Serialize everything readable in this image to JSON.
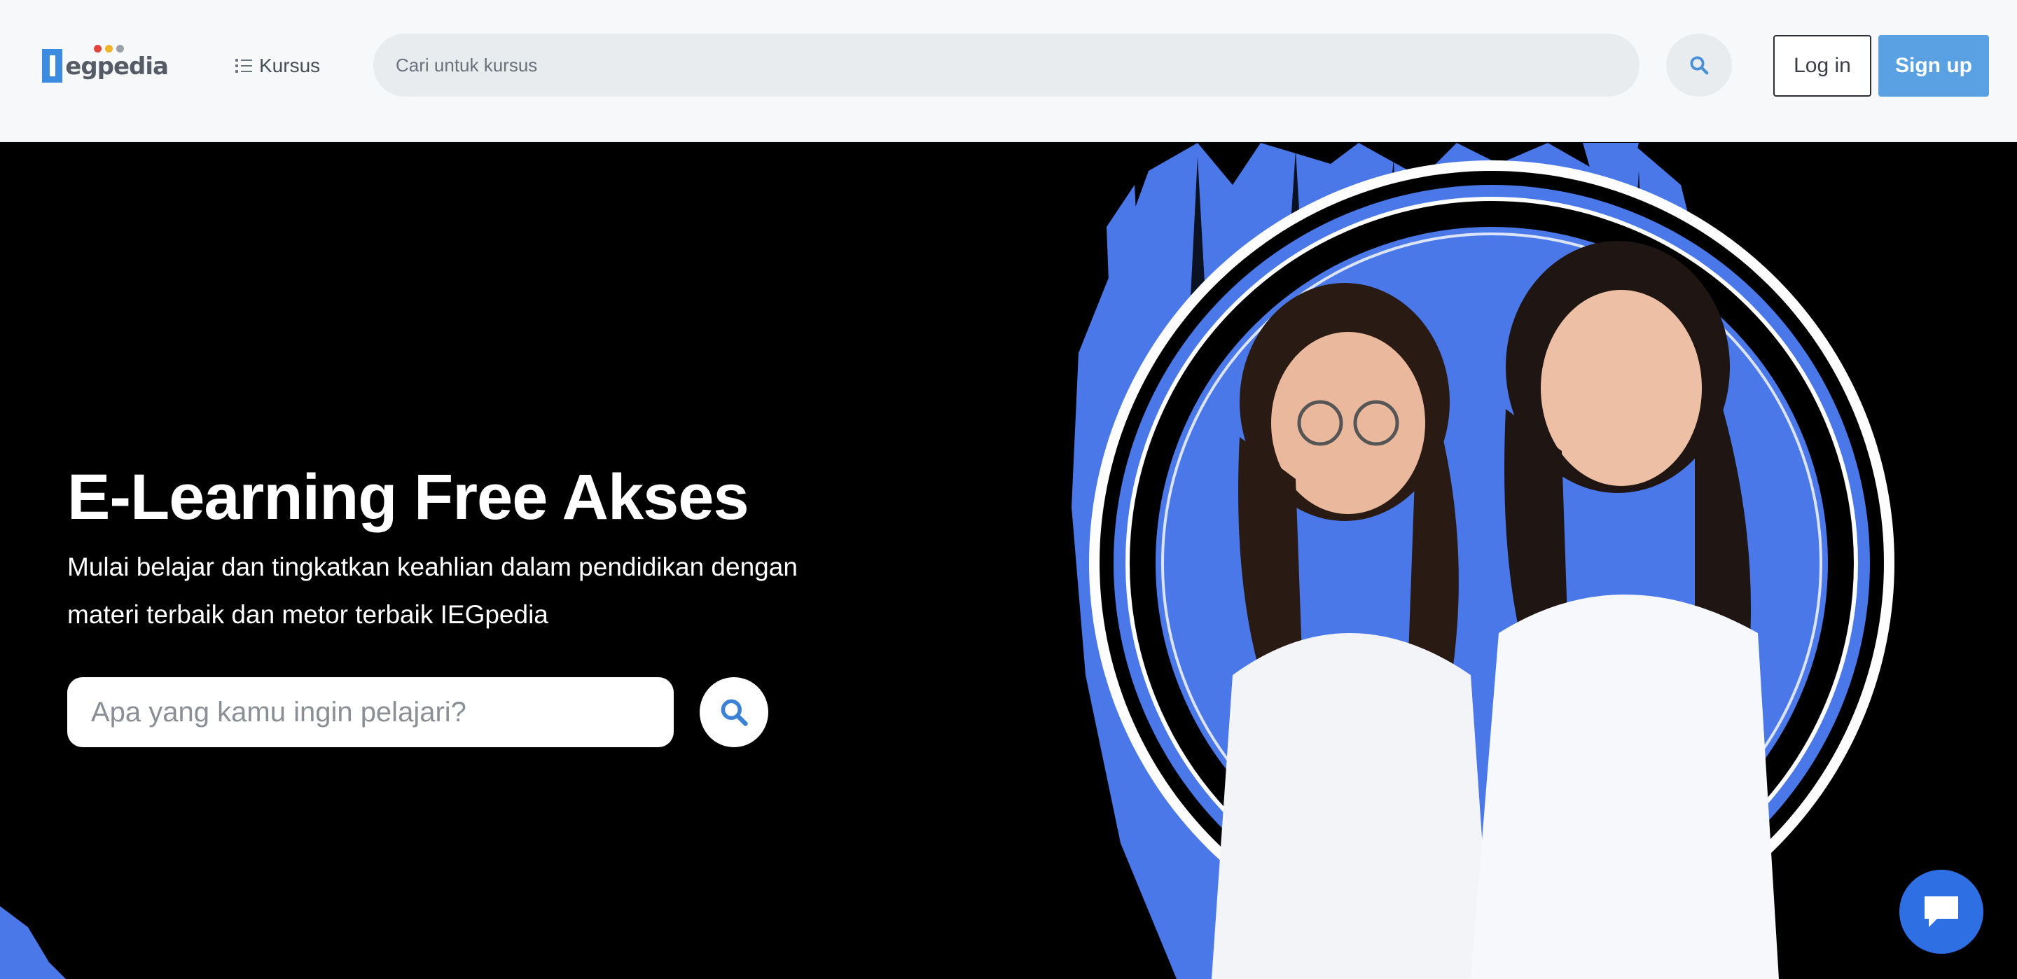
{
  "header": {
    "logo_text": "egpedia",
    "logo_dot_colors": [
      "#e0463c",
      "#f0b429",
      "#9aa0a6"
    ],
    "nav_kursus_label": "Kursus",
    "search_placeholder": "Cari untuk kursus",
    "login_label": "Log in",
    "signup_label": "Sign up"
  },
  "hero": {
    "title": "E-Learning Free Akses",
    "subtitle": "Mulai belajar dan tingkatkan keahlian dalam pendidikan dengan materi terbaik dan metor terbaik IEGpedia",
    "search_placeholder": "Apa yang kamu ingin pelajari?"
  },
  "colors": {
    "brand_blue": "#5aa1e3",
    "accent_blue": "#4a78e8",
    "hero_bg": "#000000",
    "chat_blue": "#2f6fe4"
  },
  "icons": {
    "search": "search-icon",
    "menu": "list-icon",
    "chat": "chat-icon"
  }
}
